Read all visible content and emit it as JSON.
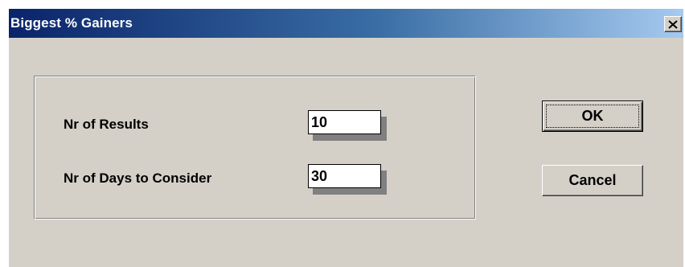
{
  "window": {
    "title": "Biggest % Gainers",
    "close_glyph": "✕"
  },
  "form": {
    "results_label": "Nr of Results",
    "results_value": "10",
    "days_label": "Nr of Days to Consider",
    "days_value": "30"
  },
  "buttons": {
    "ok_label": "OK",
    "cancel_label": "Cancel"
  },
  "colors": {
    "face": "#d4d0c8",
    "title_start": "#0a246a",
    "title_end": "#a6caf0"
  }
}
